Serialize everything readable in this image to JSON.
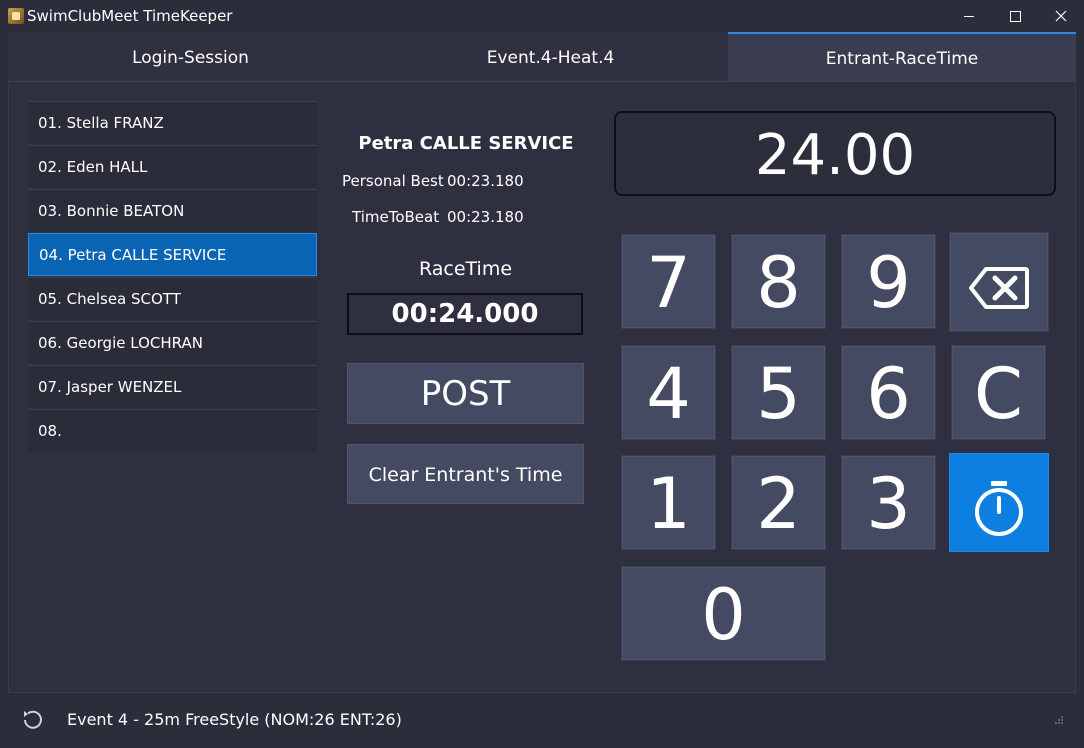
{
  "window": {
    "title": "SwimClubMeet TimeKeeper"
  },
  "tabs": [
    {
      "label": "Login-Session",
      "active": false
    },
    {
      "label": "Event.4-Heat.4",
      "active": false
    },
    {
      "label": "Entrant-RaceTime",
      "active": true
    }
  ],
  "lanes": [
    {
      "label": "01. Stella FRANZ"
    },
    {
      "label": "02. Eden HALL"
    },
    {
      "label": "03. Bonnie BEATON"
    },
    {
      "label": "04. Petra CALLE SERVICE",
      "selected": true
    },
    {
      "label": "05. Chelsea SCOTT"
    },
    {
      "label": "06. Georgie LOCHRAN"
    },
    {
      "label": "07. Jasper WENZEL"
    },
    {
      "label": "08."
    }
  ],
  "entrant": {
    "name": "Petra CALLE SERVICE",
    "personal_best_label": "Personal Best",
    "personal_best": "00:23.180",
    "time_to_beat_label": "TimeToBeat",
    "time_to_beat": "00:23.180",
    "racetime_label": "RaceTime",
    "racetime": "00:24.000"
  },
  "buttons": {
    "post": "POST",
    "clear": "Clear Entrant's Time"
  },
  "keypad": {
    "display": "24.00",
    "keys": {
      "k7": "7",
      "k8": "8",
      "k9": "9",
      "k4": "4",
      "k5": "5",
      "k6": "6",
      "k1": "1",
      "k2": "2",
      "k3": "3",
      "k0": "0",
      "clear": "C"
    },
    "icons": {
      "backspace": "backspace-icon",
      "stopwatch": "stopwatch-icon"
    },
    "accent": "#0c7fe0"
  },
  "status": {
    "text": "Event 4 - 25m FreeStyle (NOM:26 ENT:26)"
  }
}
